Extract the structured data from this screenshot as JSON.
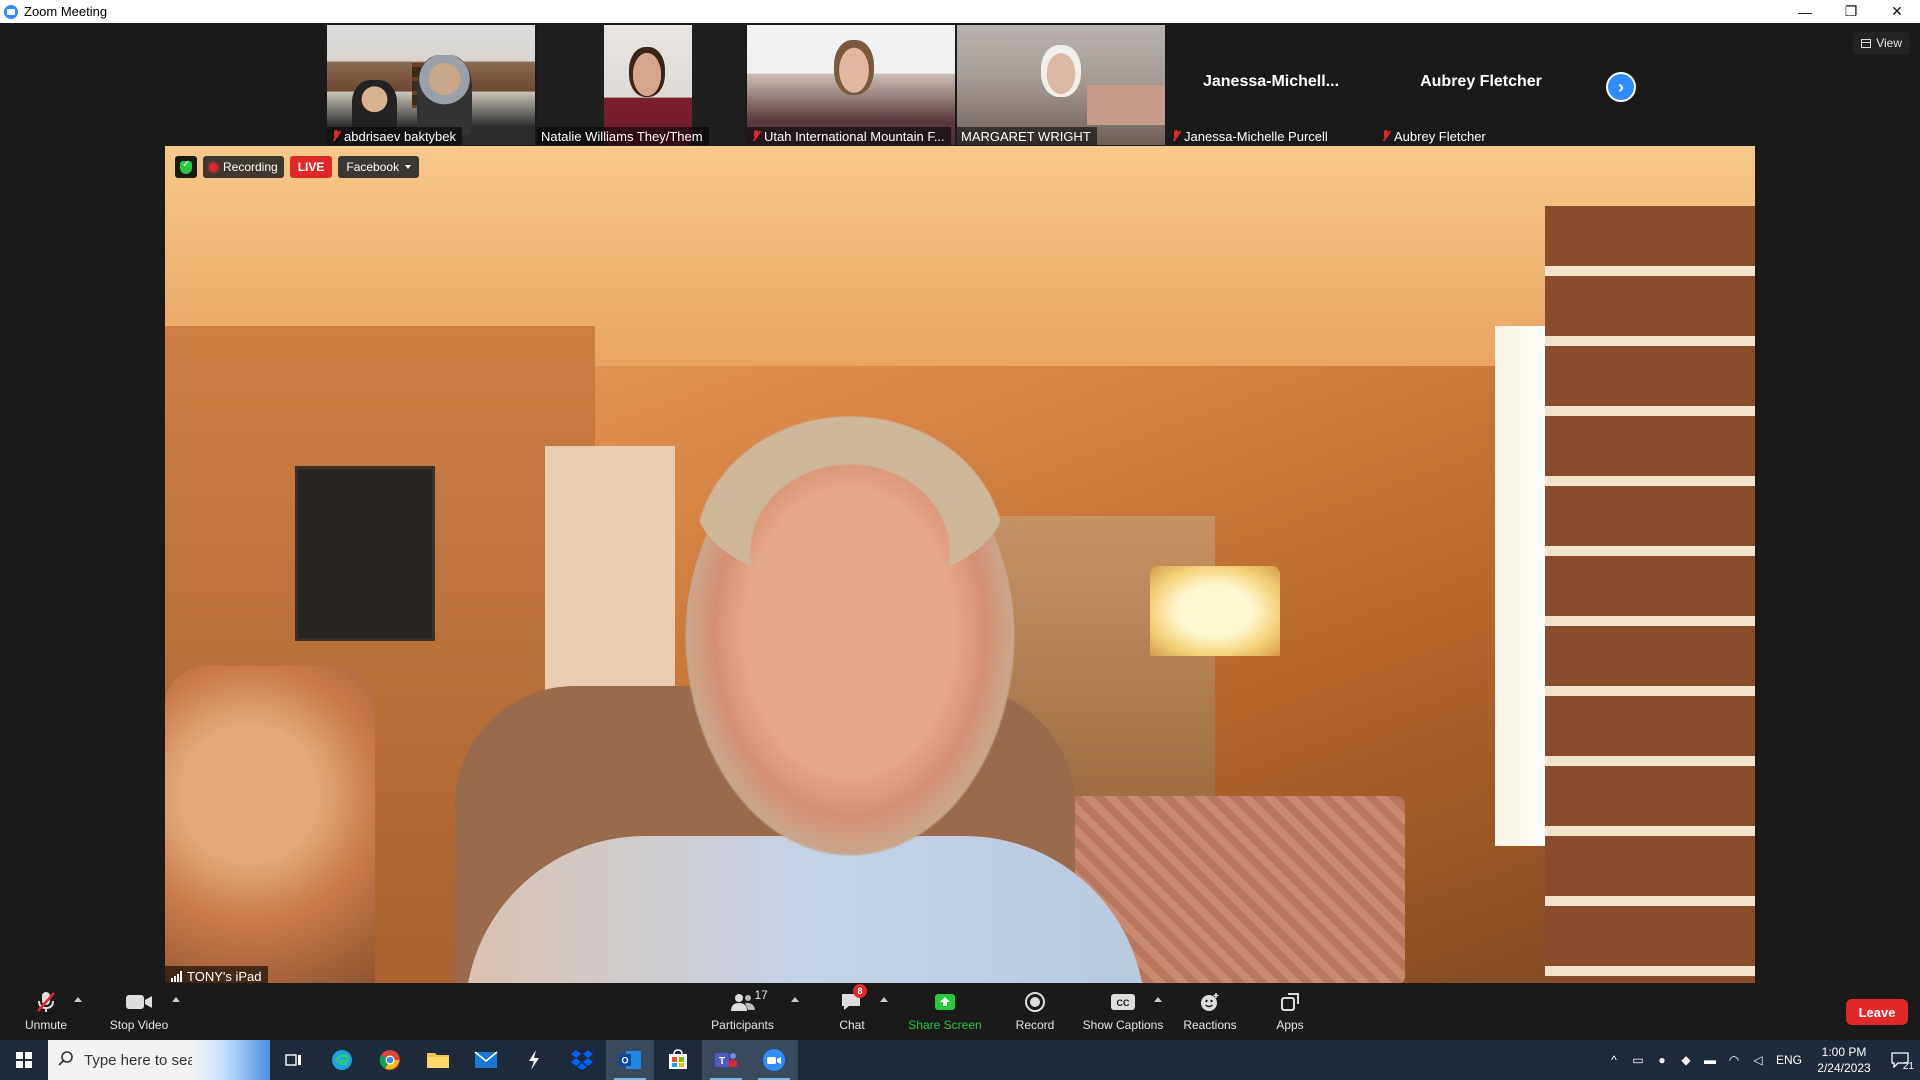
{
  "window": {
    "title": "Zoom Meeting",
    "controls": {
      "minimize": "—",
      "restore": "❐",
      "close": "✕"
    }
  },
  "view_button": {
    "label": "View",
    "icon": "grid-icon"
  },
  "gallery": {
    "tiles": [
      {
        "name": "abdrisaev baktybek",
        "muted": true,
        "video": true
      },
      {
        "name": "Natalie Williams They/Them",
        "muted": false,
        "video": true
      },
      {
        "name": "Utah International Mountain F...",
        "muted": true,
        "video": true
      },
      {
        "name": "MARGARET WRIGHT",
        "muted": false,
        "video": true
      },
      {
        "name": "Janessa-Michelle Purcell",
        "display_name": "Janessa-Michell...",
        "muted": true,
        "video": false
      },
      {
        "name": "Aubrey Fletcher",
        "display_name": "Aubrey Fletcher",
        "muted": true,
        "video": false
      }
    ],
    "next_icon": "chevron-right-icon"
  },
  "main_video": {
    "recording_label": "Recording",
    "live_label": "LIVE",
    "stream_target": "Facebook",
    "speaker_name": "TONY's iPad"
  },
  "toolbar": {
    "unmute": "Unmute",
    "stop_video": "Stop Video",
    "participants": "Participants",
    "participants_count": "17",
    "chat": "Chat",
    "chat_badge": "8",
    "share_screen": "Share Screen",
    "record": "Record",
    "show_captions": "Show Captions",
    "reactions": "Reactions",
    "apps": "Apps",
    "leave": "Leave"
  },
  "taskbar": {
    "search_placeholder": "Type here to search",
    "language": "ENG",
    "time": "1:00 PM",
    "date": "2/24/2023",
    "notification_count": "21",
    "apps": [
      "task-view-icon",
      "edge-icon",
      "chrome-icon",
      "file-explorer-icon",
      "mail-icon",
      "app-icon",
      "dropbox-icon",
      "outlook-icon",
      "store-icon",
      "teams-icon",
      "zoom-icon"
    ]
  },
  "colors": {
    "accent": "#2d8cff",
    "live_red": "#e02828",
    "share_green": "#27c93f",
    "toolbar_bg": "#1a1a1a",
    "taskbar_bg": "#1c2a3a"
  }
}
